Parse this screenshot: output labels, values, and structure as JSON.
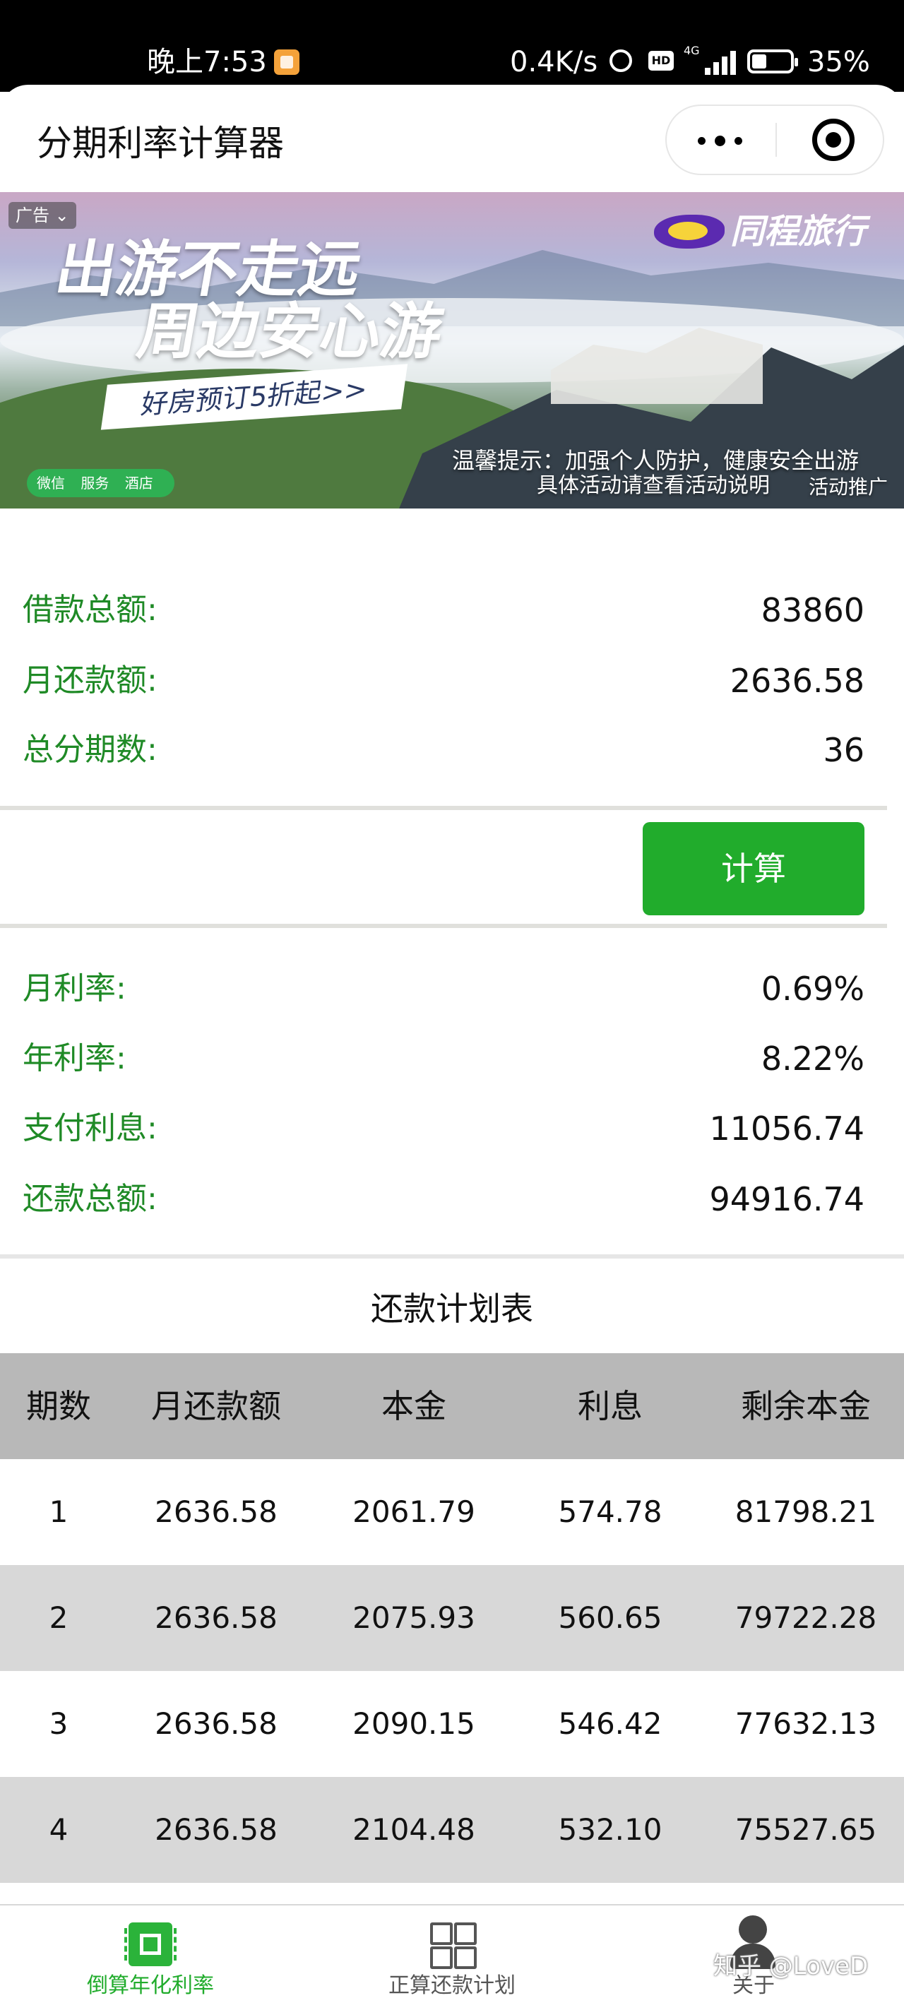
{
  "status_bar": {
    "time": "晚上7:53",
    "net_speed": "0.4K/s",
    "network": "4G",
    "battery": "35%"
  },
  "navbar": {
    "title": "分期利率计算器"
  },
  "ad": {
    "tag": "广告 ⌄",
    "brand": "同程旅行",
    "headline1": "出游不走远",
    "headline2": "周边安心游",
    "pill": "好房预订5折起>>",
    "tip1": "温馨提示：加强个人防护，健康安全出游",
    "tip2": "具体活动请查看活动说明",
    "note": "活动推广",
    "chips": [
      "微信",
      "服务",
      "酒店"
    ]
  },
  "inputs": {
    "loan_total_label": "借款总额:",
    "loan_total_value": "83860",
    "monthly_payment_label": "月还款额:",
    "monthly_payment_value": "2636.58",
    "periods_label": "总分期数:",
    "periods_value": "36"
  },
  "calc_button": "计算",
  "results": {
    "monthly_rate_label": "月利率:",
    "monthly_rate_value": "0.69%",
    "annual_rate_label": "年利率:",
    "annual_rate_value": "8.22%",
    "interest_label": "支付利息:",
    "interest_value": "11056.74",
    "total_label": "还款总额:",
    "total_value": "94916.74"
  },
  "schedule": {
    "title": "还款计划表",
    "headers": [
      "期数",
      "月还款额",
      "本金",
      "利息",
      "剩余本金"
    ],
    "rows": [
      [
        "1",
        "2636.58",
        "2061.79",
        "574.78",
        "81798.21"
      ],
      [
        "2",
        "2636.58",
        "2075.93",
        "560.65",
        "79722.28"
      ],
      [
        "3",
        "2636.58",
        "2090.15",
        "546.42",
        "77632.13"
      ],
      [
        "4",
        "2636.58",
        "2104.48",
        "532.10",
        "75527.65"
      ]
    ]
  },
  "tabbar": {
    "tabs": [
      {
        "label": "倒算年化利率",
        "icon": "chip-icon",
        "active": true
      },
      {
        "label": "正算还款计划",
        "icon": "grid-icon",
        "active": false
      },
      {
        "label": "关于",
        "icon": "user-icon",
        "active": false
      }
    ]
  },
  "watermark": "知乎 @LoveD",
  "colors": {
    "accent_green": "#21ac2c",
    "label_green": "#1f8a26",
    "table_header": "#b8b8b8",
    "row_alt": "#d8d8d8"
  }
}
